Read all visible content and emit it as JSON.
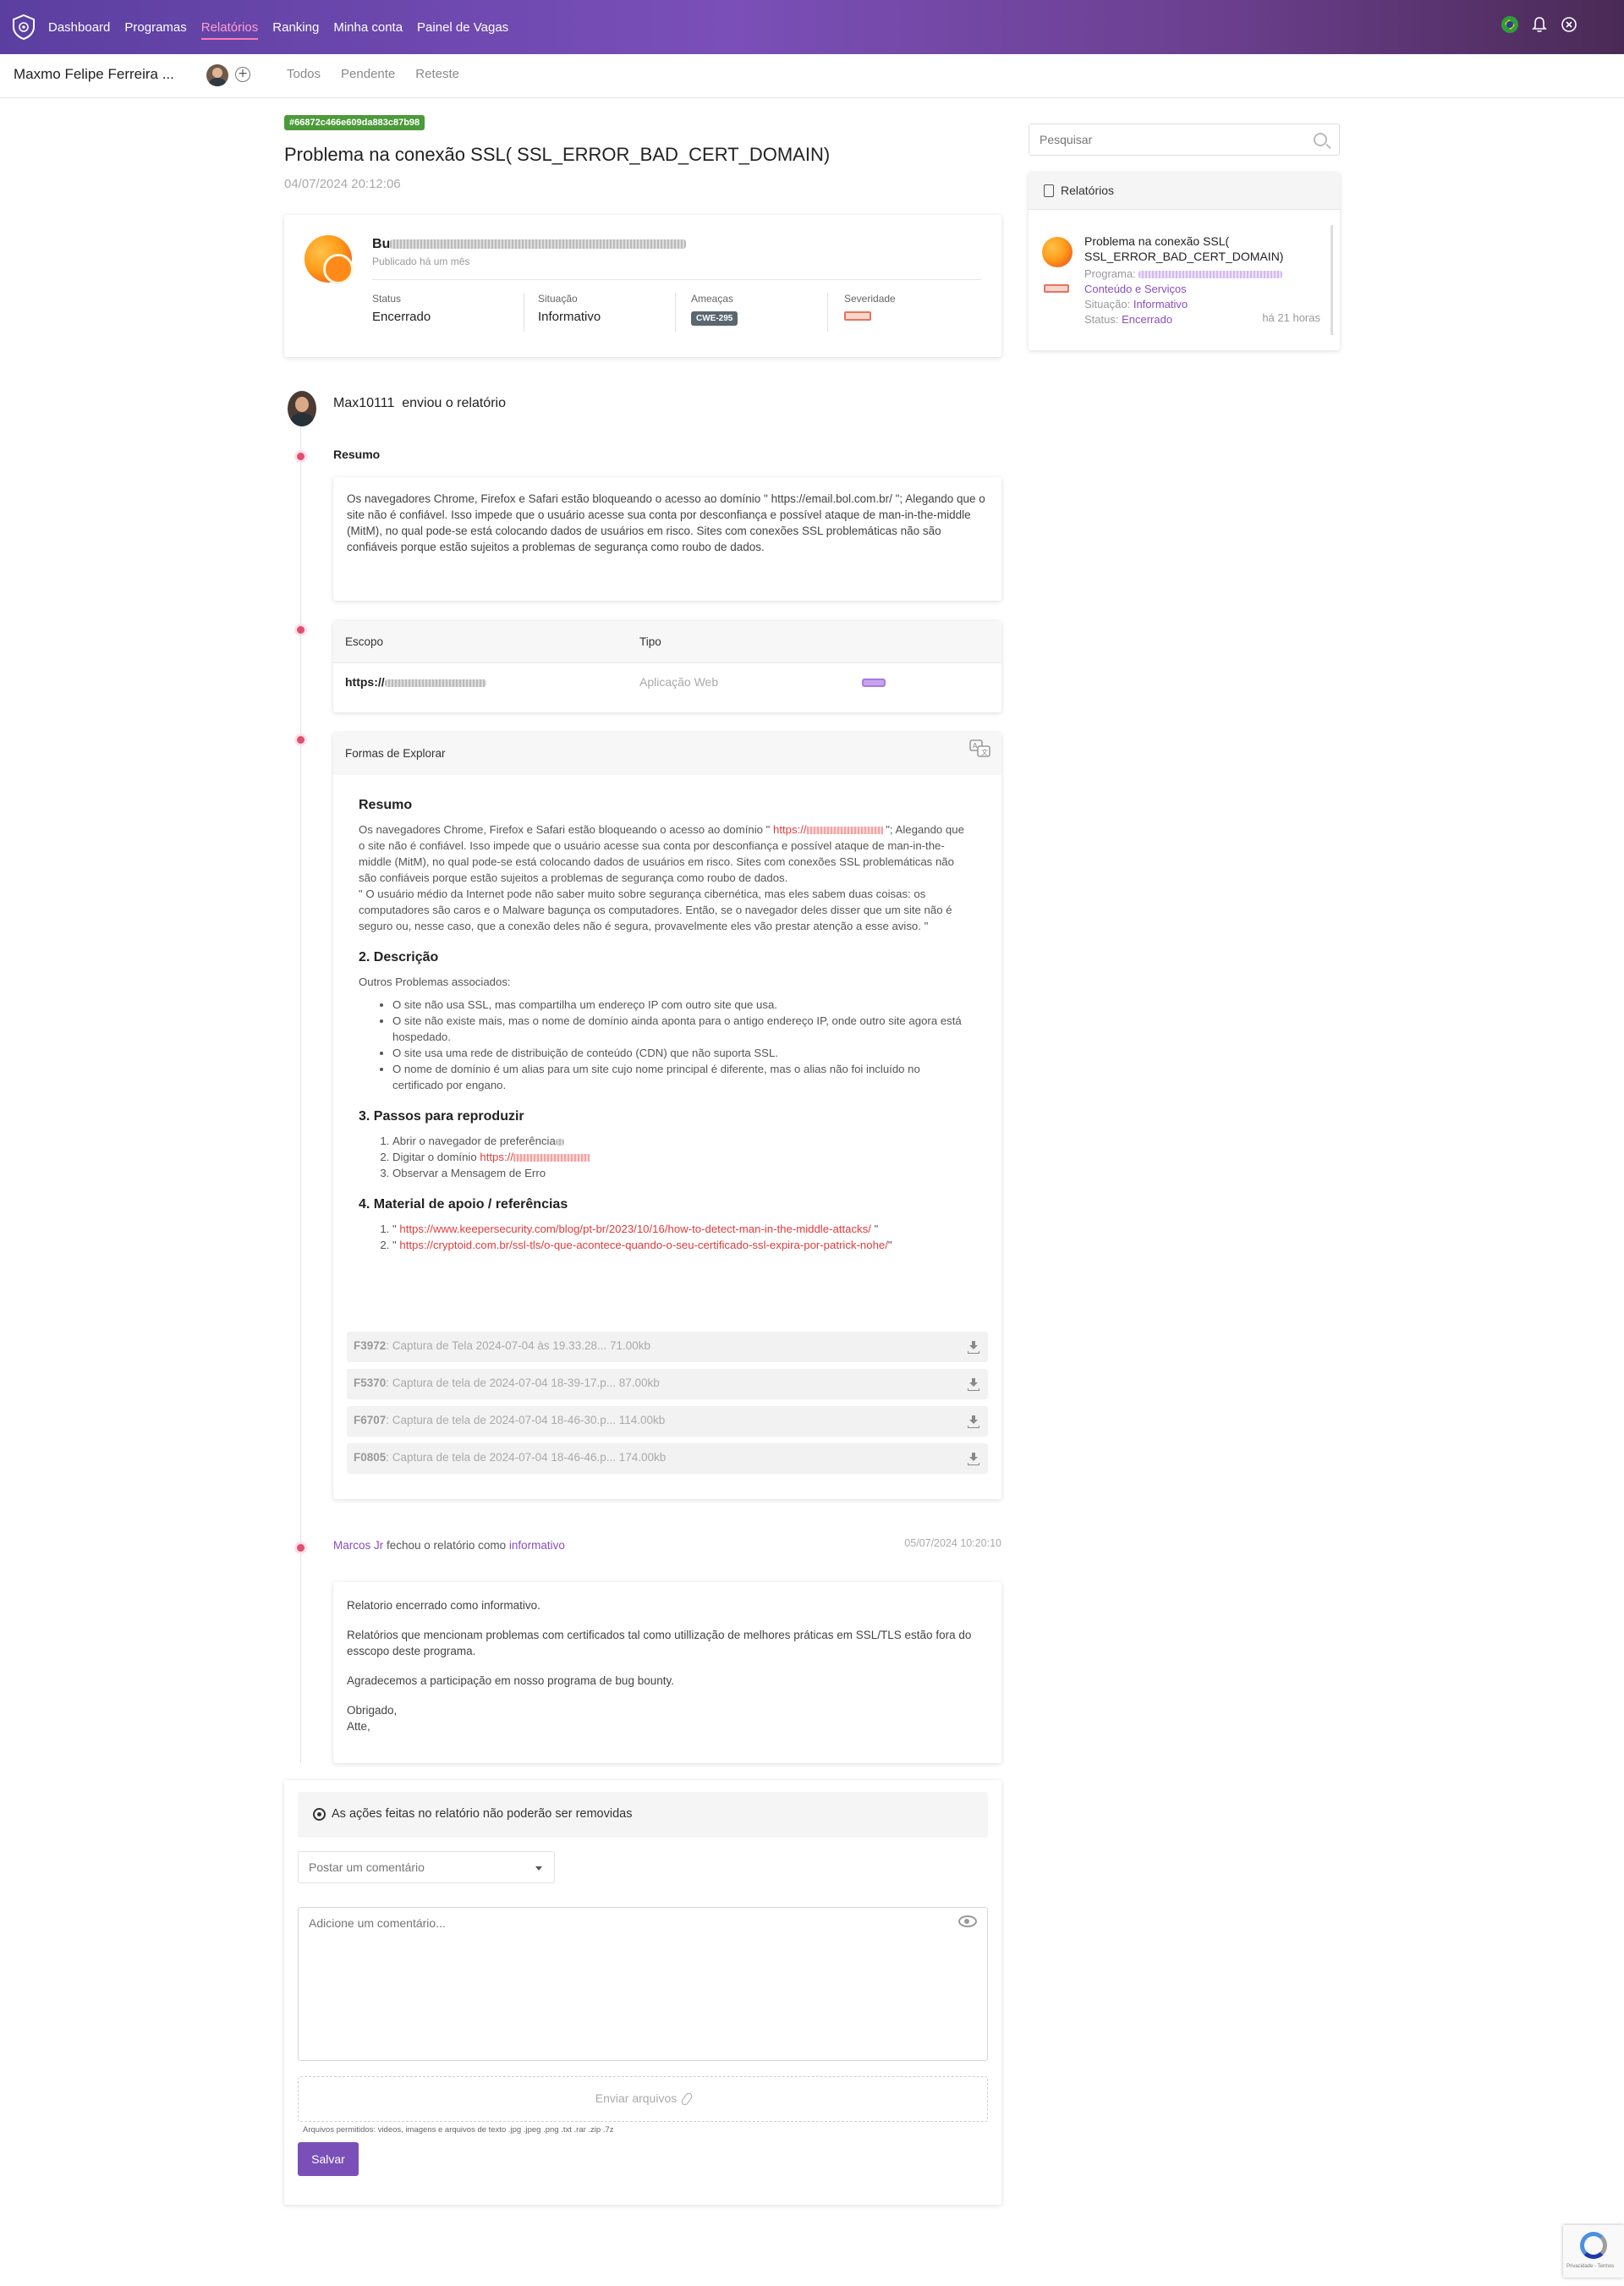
{
  "nav": {
    "links": [
      "Dashboard",
      "Programas",
      "Relatórios",
      "Ranking",
      "Minha conta",
      "Painel de Vagas"
    ],
    "active_index": 2,
    "accent_color": "#7a4fb8"
  },
  "subbar": {
    "user_name": "Maxmo Felipe Ferreira ...",
    "tabs": [
      "Todos",
      "Pendente",
      "Reteste"
    ]
  },
  "report": {
    "hash": "#66872c466e609da883c87b98",
    "title": "Problema na conexão SSL( SSL_ERROR_BAD_CERT_DOMAIN)",
    "date": "04/07/2024 20:12:06",
    "org_name_prefix": "Bu",
    "published": "Publicado há um mês",
    "status_label": "Status",
    "status_value": "Encerrado",
    "situacao_label": "Situação",
    "situacao_value": "Informativo",
    "ameacas_label": "Ameaças",
    "ameacas_value": "CWE-295",
    "severidade_label": "Severidade"
  },
  "sidebar": {
    "search_placeholder": "Pesquisar",
    "title": "Relatórios",
    "item": {
      "title": "Problema na conexão SSL( SSL_ERROR_BAD_CERT_DOMAIN)",
      "programa_label": "Programa:",
      "category": "Conteúdo e Serviços",
      "situacao_label": "Situação:",
      "situacao_value": "Informativo",
      "status_label": "Status:",
      "status_value": "Encerrado",
      "time": "há 21 horas"
    }
  },
  "timeline": {
    "author": "Max10111",
    "author_action": "enviou o relatório",
    "resumo_label": "Resumo",
    "resumo_text": "Os navegadores Chrome, Firefox e Safari estão bloqueando o acesso ao domínio \" https://email.bol.com.br/ \"; Alegando que o site não é confiável. Isso impede que o usuário acesse sua conta por desconfiança e possível ataque de man-in-the-middle (MitM), no qual pode-se está colocando dados de usuários em risco. Sites com conexões SSL problemáticas não são confiáveis porque estão sujeitos a problemas de segurança como roubo de dados.",
    "scope": {
      "col_escopo": "Escopo",
      "col_tipo": "Tipo",
      "escopo_value": "https://",
      "tipo_value": "Aplicação Web"
    },
    "explore": {
      "title": "Formas de Explorar",
      "h_resumo": "Resumo",
      "p1_a": "Os navegadores Chrome, Firefox e Safari estão bloqueando o acesso ao domínio \" ",
      "p1_link": "https://",
      "p1_b": " \"; Alegando que o site não é confiável. Isso impede que o usuário acesse sua conta por desconfiança e possível ataque de man-in-the-middle (MitM), no qual pode-se está colocando dados de usuários em risco. Sites com conexões SSL problemáticas não são confiáveis porque estão sujeitos a problemas de segurança como roubo de dados.",
      "p2": "\" O usuário médio da Internet pode não saber muito sobre segurança cibernética, mas eles sabem duas coisas: os computadores são caros e o Malware bagunça os computadores. Então, se o navegador deles disser que um site não é seguro ou, nesse caso, que a conexão deles não é segura, provavelmente eles vão prestar atenção a esse aviso. \"",
      "h_descricao": "2. Descrição",
      "desc_intro": "Outros Problemas associados:",
      "desc_items": [
        "O site não usa SSL, mas compartilha um endereço IP com outro site que usa.",
        "O site não existe mais, mas o nome de domínio ainda aponta para o antigo endereço IP, onde outro site agora está hospedado.",
        "O site usa uma rede de distribuição de conteúdo (CDN) que não suporta SSL.",
        "O nome de domínio é um alias para um site cujo nome principal é diferente, mas o alias não foi incluído no certificado por engano."
      ],
      "h_passos": "3. Passos para reproduzir",
      "step1": "Abrir o navegador de preferência",
      "step2_a": "Digitar o domínio ",
      "step2_link": "https://",
      "step3": "Observar a Mensagem de Erro",
      "h_material": "4. Material de apoio / referências",
      "refs": [
        "https://www.keepersecurity.com/blog/pt-br/2023/10/16/how-to-detect-man-in-the-middle-attacks/",
        "https://cryptoid.com.br/ssl-tls/o-que-acontece-quando-o-seu-certificado-ssl-expira-por-patrick-nohe/"
      ],
      "attachments": [
        {
          "id": "F3972",
          "name": ": Captura de Tela 2024-07-04 às 19.33.28... 71.00kb"
        },
        {
          "id": "F5370",
          "name": ": Captura de tela de 2024-07-04 18-39-17.p... 87.00kb"
        },
        {
          "id": "F6707",
          "name": ": Captura de tela de 2024-07-04 18-46-30.p... 114.00kb"
        },
        {
          "id": "F0805",
          "name": ": Captura de tela de 2024-07-04 18-46-46.p... 174.00kb"
        }
      ]
    },
    "closed": {
      "who": "Marcos Jr",
      "action": " fechou o relatório como ",
      "as": "informativo",
      "date": "05/07/2024 10:20:10",
      "p1": "Relatorio encerrado como informativo.",
      "p2": "Relatórios que mencionam problemas com certificados tal como utillização de melhores práticas em SSL/TLS estão fora do esscopo deste programa.",
      "p3": "Agradecemos a participação em nosso programa de bug bounty.",
      "p4": "Obrigado,",
      "p5": "Atte,"
    }
  },
  "comment": {
    "warning": "As ações feitas no relatório não poderão ser removidas",
    "select_value": "Postar um comentário",
    "textarea_placeholder": "Adicione um comentário...",
    "upload_label": "Enviar arquivos",
    "allowed": "Arquivos permitidos: videos, imagens e arquivos de texto .jpg .jpeg .png .txt .rar .zip .7z",
    "save_label": "Salvar"
  },
  "recaptcha_text": "Privacidade - Termos"
}
